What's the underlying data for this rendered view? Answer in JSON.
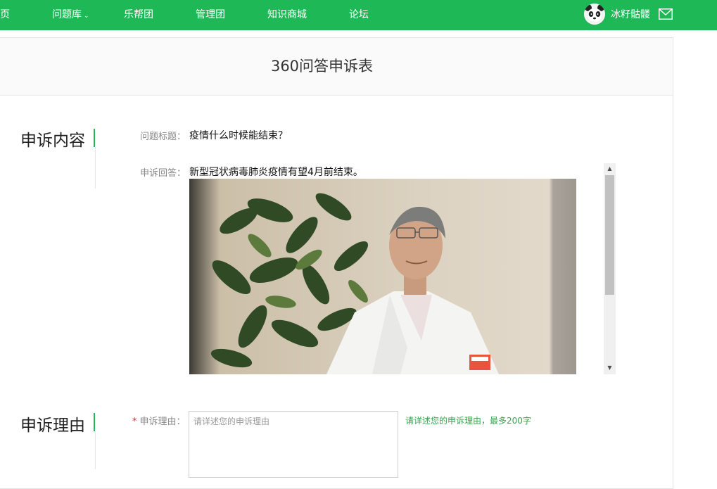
{
  "nav": {
    "items": [
      {
        "label": "页"
      },
      {
        "label": "问题库",
        "has_dropdown": true,
        "dropdown_icon": "chevron-down-icon"
      },
      {
        "label": "乐帮团"
      },
      {
        "label": "管理团"
      },
      {
        "label": "知识商城"
      },
      {
        "label": "论坛"
      }
    ],
    "user": {
      "name": "冰籽骷髅",
      "avatar": "panda-avatar"
    },
    "mail_icon": "mail-icon",
    "bar_color": "#1fb857"
  },
  "page": {
    "title": "360问答申诉表"
  },
  "section_content": {
    "title": "申诉内容",
    "question_label": "问题标题：",
    "question_value": "疫情什么时候能结束？",
    "answer_label": "申诉回答：",
    "answer_value": "新型冠状病毒肺炎疫情有望4月前结束。",
    "answer_image": "photo-doctor-in-white-coat"
  },
  "section_reason": {
    "title": "申诉理由",
    "required_mark": "*",
    "reason_label": "申诉理由：",
    "reason_placeholder": "请详述您的申诉理由",
    "reason_value": "",
    "reason_hint": "请详述您的申诉理由，最多200字"
  },
  "colors": {
    "accent": "#1fb857",
    "hint": "#3aa24f",
    "required": "#e23333"
  }
}
